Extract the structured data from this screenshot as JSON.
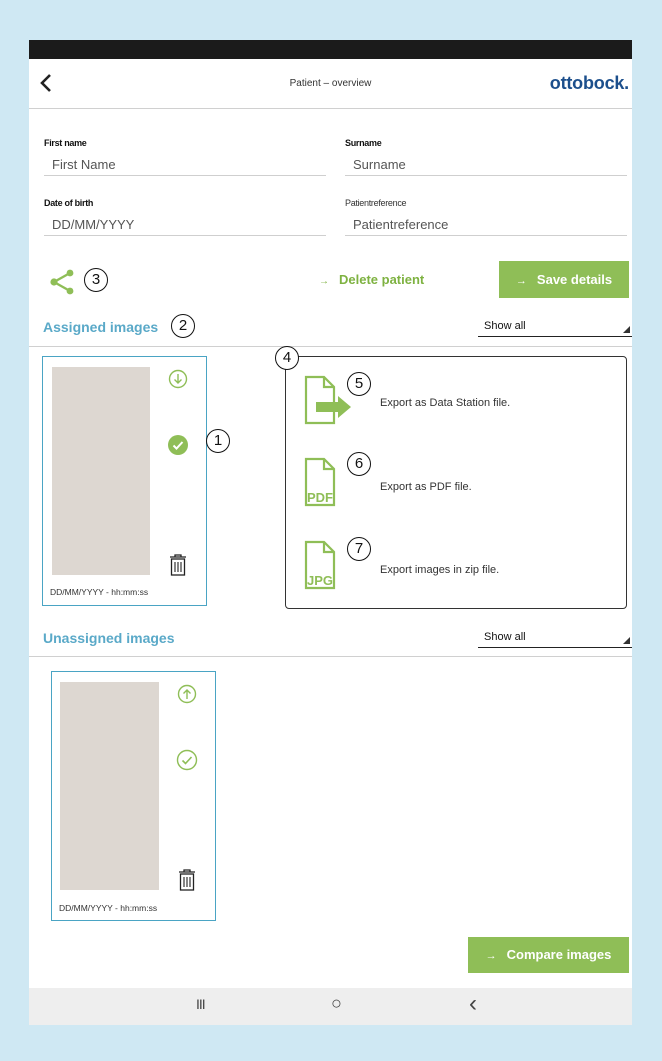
{
  "header": {
    "title": "Patient – overview",
    "logo": "ottobock."
  },
  "form": {
    "first_name": {
      "label": "First name",
      "placeholder": "First Name"
    },
    "surname": {
      "label": "Surname",
      "placeholder": "Surname"
    },
    "dob": {
      "label": "Date of birth",
      "placeholder": "DD/MM/YYYY"
    },
    "patientreference": {
      "label": "Patientreference",
      "placeholder": "Patientreference"
    }
  },
  "actions": {
    "delete_label": "Delete patient",
    "save_label": "Save details",
    "compare_label": "Compare images",
    "arrow": "→"
  },
  "assigned": {
    "title": "Assigned images",
    "filter": "Show all",
    "card": {
      "date": "DD/MM/YYYY - hh:mm:ss"
    }
  },
  "unassigned": {
    "title": "Unassigned images",
    "filter": "Show all",
    "card": {
      "date": "DD/MM/YYYY - hh:mm:ss"
    }
  },
  "export_menu": {
    "items": [
      {
        "label": "Export as Data Station file.",
        "icon": "data-station-file-icon"
      },
      {
        "label": "Export as PDF file.",
        "icon": "pdf-file-icon",
        "badge": "PDF"
      },
      {
        "label": "Export images in zip file.",
        "icon": "jpg-file-icon",
        "badge": "JPG"
      }
    ]
  },
  "callouts": [
    "1",
    "2",
    "3",
    "4",
    "5",
    "6",
    "7"
  ],
  "navbar": {
    "recents": "III",
    "home": "○",
    "back": "‹"
  },
  "colors": {
    "accent_green": "#8fbe57",
    "accent_blue": "#5aa9c8",
    "logo_blue": "#1c4f8c"
  }
}
